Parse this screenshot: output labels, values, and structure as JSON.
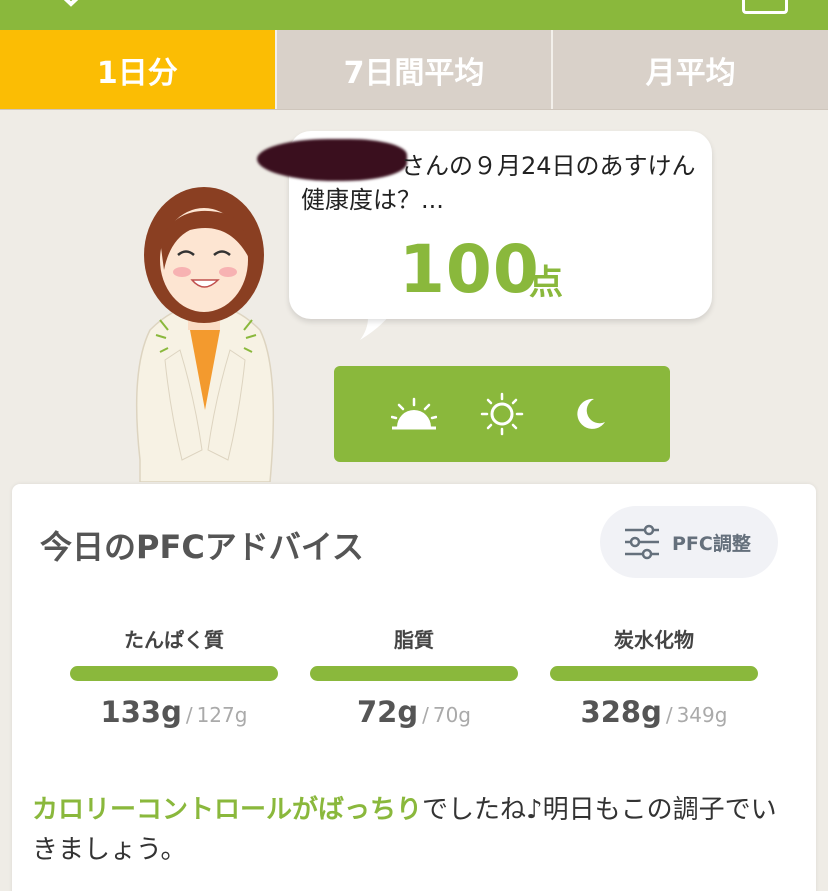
{
  "tabs": [
    {
      "label": "1日分",
      "active": true
    },
    {
      "label": "7日間平均",
      "active": false
    },
    {
      "label": "月平均",
      "active": false
    }
  ],
  "bubble": {
    "message": "さんの９月24日のあすけん健康度は？...",
    "score": "100",
    "score_unit": "点"
  },
  "time_buttons": [
    {
      "icon": "sunrise-icon"
    },
    {
      "icon": "sun-icon"
    },
    {
      "icon": "moon-icon"
    }
  ],
  "card": {
    "title": "今日のPFCアドバイス",
    "adjust_label": "PFC調整",
    "nutrients": [
      {
        "name": "たんぱく質",
        "actual": "133g",
        "target": "127g"
      },
      {
        "name": "脂質",
        "actual": "72g",
        "target": "70g"
      },
      {
        "name": "炭水化物",
        "actual": "328g",
        "target": "349g"
      }
    ],
    "advice_highlight": "カロリーコントロールがばっちり",
    "advice_rest": "でしたね♪明日もこの調子でいきましょう。"
  },
  "colors": {
    "brand_green": "#8ab83c",
    "tab_active": "#fbbd04",
    "tab_inactive": "#d9d1c9",
    "background": "#efece6"
  },
  "separator": "/"
}
